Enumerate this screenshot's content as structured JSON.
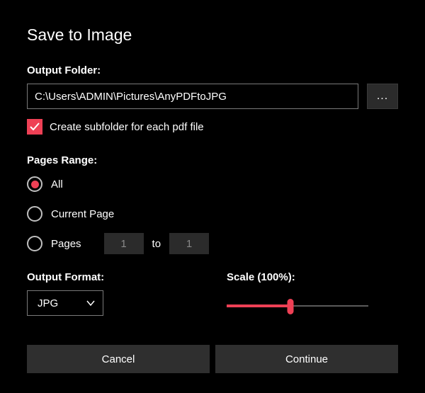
{
  "dialog": {
    "title": "Save to Image"
  },
  "outputFolder": {
    "label": "Output Folder:",
    "value": "C:\\Users\\ADMIN\\Pictures\\AnyPDFtoJPG",
    "browseLabel": "..."
  },
  "subfolder": {
    "checked": true,
    "label": "Create subfolder for each pdf file"
  },
  "pagesRange": {
    "label": "Pages Range:",
    "options": {
      "all": "All",
      "current": "Current Page",
      "pages": "Pages"
    },
    "selected": "all",
    "fromValue": "1",
    "toLabel": "to",
    "toValue": "1"
  },
  "outputFormat": {
    "label": "Output Format:",
    "value": "JPG"
  },
  "scale": {
    "label": "Scale (100%):",
    "percent": 100
  },
  "actions": {
    "cancel": "Cancel",
    "continue": "Continue"
  },
  "colors": {
    "accent": "#ee4055"
  }
}
